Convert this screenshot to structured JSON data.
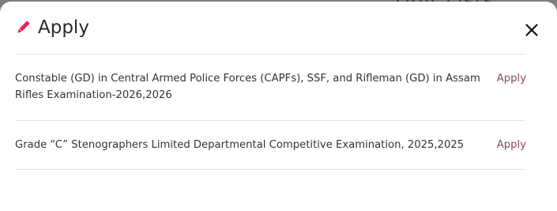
{
  "background": {
    "peek_text": "Unit Lists"
  },
  "modal": {
    "title": "Apply",
    "accent_color": "#e8245c",
    "link_color": "#8a4b5a"
  },
  "items": [
    {
      "label": "Constable (GD) in Central Armed Police Forces (CAPFs), SSF, and Rifleman (GD) in Assam Rifles Examination-2026,2026",
      "action_label": "Apply"
    },
    {
      "label": "Grade “C” Stenographers Limited Departmental Competitive Examination, 2025,2025",
      "action_label": "Apply"
    }
  ]
}
